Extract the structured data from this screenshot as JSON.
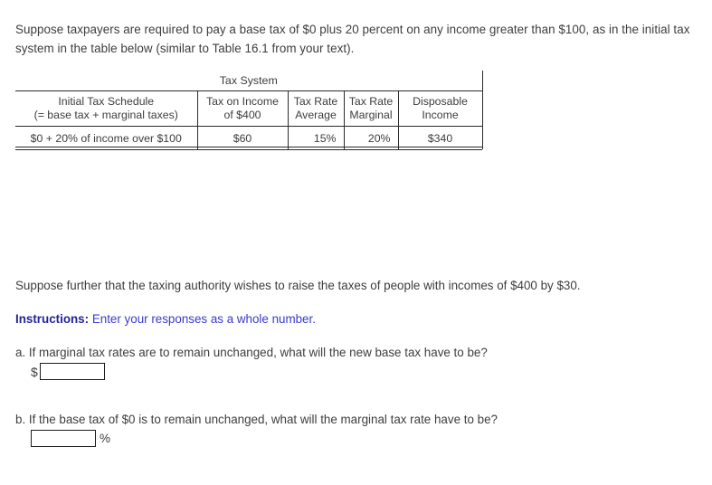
{
  "intro": {
    "paragraph": "Suppose taxpayers are required to pay a base tax of $0 plus 20 percent on any income greater than $100, as in the initial tax system in the table below (similar to Table 16.1 from your text)."
  },
  "table": {
    "title": "Tax System",
    "headers": [
      "Initial Tax Schedule\n(= base tax + marginal taxes)",
      "Tax on Income\nof $400",
      "Tax Rate\nAverage",
      "Tax Rate\nMarginal",
      "Disposable\nIncome"
    ],
    "header_lines": {
      "h1_line1": "Initial Tax Schedule",
      "h1_line2": "(= base tax + marginal taxes)",
      "h2_line1": "Tax on Income",
      "h2_line2": "of $400",
      "h3_line1": "Tax Rate",
      "h3_line2": "Average",
      "h4_line1": "Tax Rate",
      "h4_line2": "Marginal",
      "h5_line1": "Disposable",
      "h5_line2": "Income"
    },
    "rows": [
      {
        "schedule": "$0 + 20% of income over $100",
        "tax_on_income": "$60",
        "tax_rate_average": "15%",
        "tax_rate_marginal": "20%",
        "disposable_income": "$340"
      }
    ]
  },
  "further": {
    "text": "Suppose further that the taxing authority wishes to raise the taxes of people with incomes of $400 by $30."
  },
  "instructions": {
    "label": "Instructions:",
    "text": "Enter your responses as a whole number.",
    "color": "#2b2bc8"
  },
  "questions": {
    "a": {
      "prompt": "a. If marginal tax rates are to remain unchanged, what will the new base tax have to be?",
      "prefix": "$",
      "value": "",
      "placeholder": ""
    },
    "b": {
      "prompt": "b. If the base tax of $0 is to remain unchanged, what will the marginal tax rate have to be?",
      "suffix": "%",
      "value": "",
      "placeholder": ""
    }
  }
}
